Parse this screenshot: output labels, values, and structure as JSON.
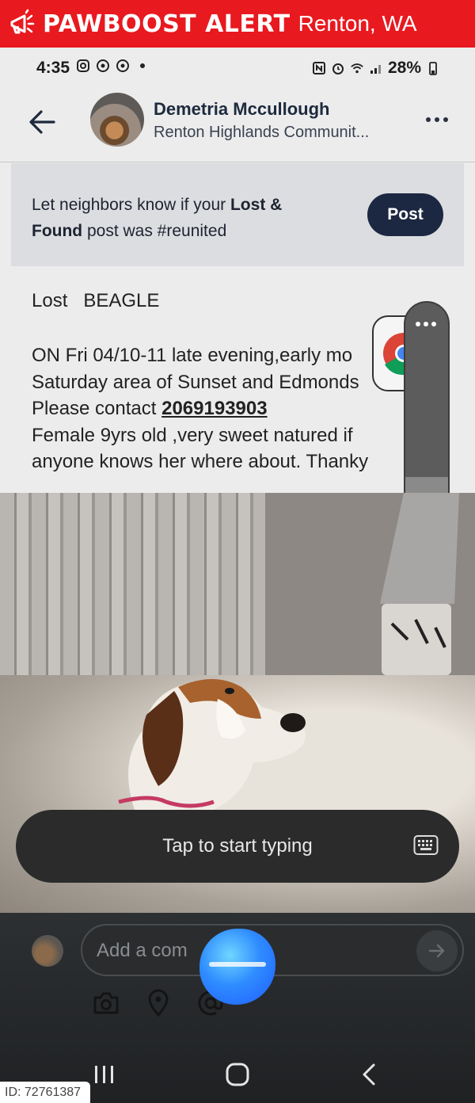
{
  "alert": {
    "brand": "PAWBOOST ALERT",
    "location": "Renton, WA",
    "icon": "megaphone-icon"
  },
  "status_bar": {
    "time": "4:35",
    "battery": "28%"
  },
  "header": {
    "author": "Demetria Mccullough",
    "community": "Renton Highlands Communit..."
  },
  "banner": {
    "text_1": "Let neighbors know if your ",
    "bold_1": "Lost &",
    "bold_2": "Found",
    "text_2": " post was #reunited",
    "post_label": "Post"
  },
  "post": {
    "title": "Lost   BEAGLE",
    "line_1": "ON Fri 04/10-11 late evening,early mo",
    "line_2": "Saturday area of Sunset and Edmonds",
    "line_3_prefix": "Please contact ",
    "phone": "2069193903",
    "line_4": "Female 9yrs old ,very sweet natured if",
    "line_5": "anyone knows her where about. Thanky"
  },
  "overlay": {
    "typing_label": "Tap to start typing"
  },
  "comment": {
    "placeholder": "Add a com"
  },
  "watermark": {
    "id": "ID: 72761387"
  },
  "colors": {
    "alert_red": "#e8191f",
    "post_button": "#1c2841"
  }
}
